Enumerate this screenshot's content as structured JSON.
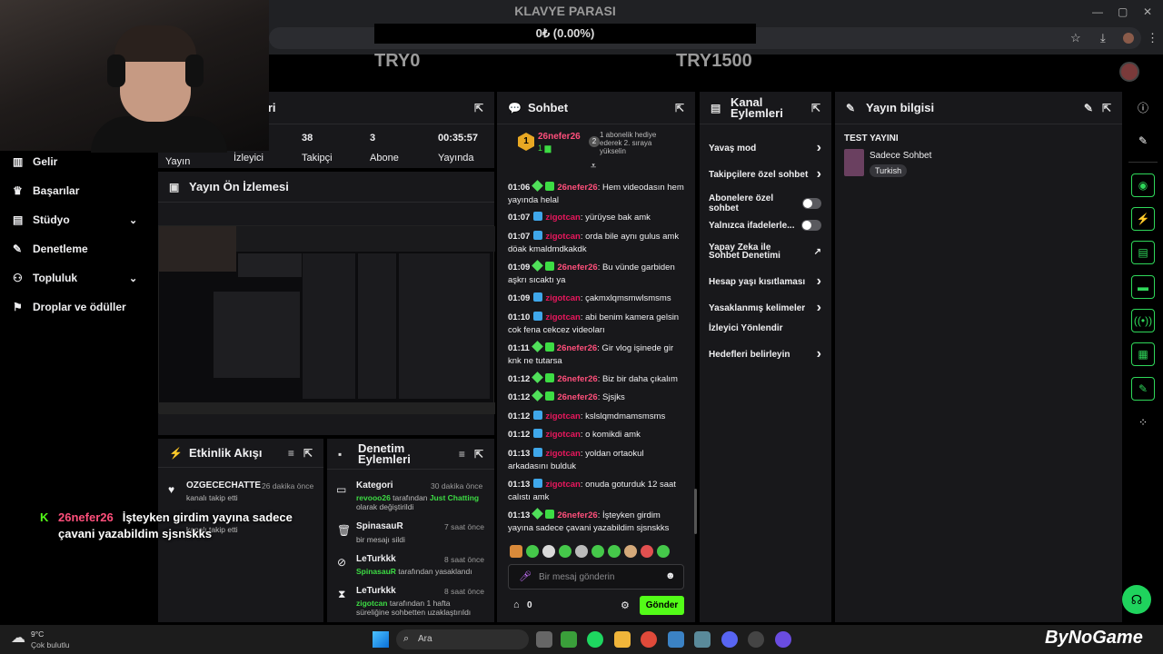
{
  "overlay": {
    "title": "KLAVYE PARASI",
    "progress": "0₺ (0.00%)",
    "progress_fraction": 0.0,
    "goal_min": "TRY0",
    "goal_max": "TRY1500"
  },
  "stats_panel": {
    "title_fragment": "leri",
    "stats": [
      {
        "value": "",
        "label": "Yayın"
      },
      {
        "value": "",
        "label": "İzleyici"
      },
      {
        "value": "38",
        "label": "Takipçi"
      },
      {
        "value": "3",
        "label": "Abone"
      },
      {
        "value": "00:35:57",
        "label": "Yayında"
      }
    ]
  },
  "nav": [
    {
      "label": "Gelir",
      "icon": "chart-icon"
    },
    {
      "label": "Başarılar",
      "icon": "trophy-icon"
    },
    {
      "label": "Stüdyo",
      "icon": "studio-icon",
      "expandable": true
    },
    {
      "label": "Denetleme",
      "icon": "wrench-icon"
    },
    {
      "label": "Topluluk",
      "icon": "people-icon",
      "expandable": true
    },
    {
      "label": "Droplar ve ödüller",
      "icon": "gift-icon"
    }
  ],
  "preview": {
    "title": "Yayın Ön İzlemesi"
  },
  "activity": {
    "title": "Etkinlik Akışı",
    "items": [
      {
        "name": "OZGECECHATTE",
        "time": "26 dakika önce",
        "desc": "kanalı takip etti"
      },
      {
        "name": "",
        "time": "",
        "desc": "kanalı takip etti"
      }
    ]
  },
  "mod": {
    "title": "Denetim Eylemleri",
    "items": [
      {
        "title": "Kategori",
        "time": "30 dakika önce",
        "user": "revooo26",
        "mid": " tarafından ",
        "target": "Just Chatting",
        "rest": "olarak değiştirildi"
      },
      {
        "title": "SpinasauR",
        "time": "7 saat önce",
        "rest": "bir mesajı sildi"
      },
      {
        "title": "LeTurkkk",
        "time": "8 saat önce",
        "user": "SpinasauR",
        "mid": " tarafından yasaklandı"
      },
      {
        "title": "LeTurkkk",
        "time": "8 saat önce",
        "user": "zigotcan",
        "mid": " tarafından 1 hafta",
        "rest": "süreliğine sohbetten uzaklaştırıldı"
      }
    ]
  },
  "chat": {
    "title": "Sohbet",
    "pinned": {
      "rank": "1",
      "user": "26nefer26",
      "count": "1",
      "sub_count": "2",
      "text": "1 abonelik hediye ederek 2. sıraya yükselin"
    },
    "messages": [
      {
        "time": "01:06",
        "user": "26nefer26",
        "text": ": Hem videodasın hem yayında helal",
        "type": 1
      },
      {
        "time": "01:07",
        "user": "zigotcan",
        "text": ": yürüyse bak amk",
        "type": 2
      },
      {
        "time": "01:07",
        "user": "zigotcan",
        "text": ": orda bile aynı gulus amk döak kmaldmdkakdk",
        "type": 2
      },
      {
        "time": "01:09",
        "user": "26nefer26",
        "text": ": Bu vünde garbiden aşkrı sıcaktı ya",
        "type": 1
      },
      {
        "time": "01:09",
        "user": "zigotcan",
        "text": ": çakmxlqmsmwlsmsms",
        "type": 2
      },
      {
        "time": "01:10",
        "user": "zigotcan",
        "text": ": abi benim kamera gelsin cok fena cekcez videoları",
        "type": 2
      },
      {
        "time": "01:11",
        "user": "26nefer26",
        "text": ": Gir vlog işinede gir knk ne tutarsa",
        "type": 1
      },
      {
        "time": "01:12",
        "user": "26nefer26",
        "text": ": Biz bir daha çıkalım",
        "type": 1
      },
      {
        "time": "01:12",
        "user": "26nefer26",
        "text": ": Sjsjks",
        "type": 1
      },
      {
        "time": "01:12",
        "user": "zigotcan",
        "text": ": kslslqmdmamsmsms",
        "type": 2
      },
      {
        "time": "01:12",
        "user": "zigotcan",
        "text": ": o komikdi amk",
        "type": 2
      },
      {
        "time": "01:13",
        "user": "zigotcan",
        "text": ": yoldan ortaokul arkadasını bulduk",
        "type": 2
      },
      {
        "time": "01:13",
        "user": "zigotcan",
        "text": ": onuda goturduk 12 saat calıstı amk",
        "type": 2
      },
      {
        "time": "01:13",
        "user": "26nefer26",
        "text": ": İşteyken girdim yayına sadece çavani yazabildim sjsnskks",
        "type": 1
      }
    ],
    "input_placeholder": "Bir mesaj gönderin",
    "points": "0",
    "send": "Gönder"
  },
  "channel_actions": {
    "title": "Kanal Eylemleri",
    "items": [
      {
        "label": "Yavaş mod",
        "ctl": "chevron"
      },
      {
        "label": "Takipçilere özel sohbet",
        "ctl": "chevron"
      },
      {
        "label": "Abonelere özel sohbet",
        "ctl": "toggle"
      },
      {
        "label": "Yalnızca ifadelerle...",
        "ctl": "toggle"
      },
      {
        "label": "Yapay Zeka ile Sohbet Denetimi",
        "ctl": "external"
      },
      {
        "label": "Hesap yaşı kısıtlaması",
        "ctl": "chevron"
      },
      {
        "label": "Yasaklanmış kelimeler",
        "ctl": "chevron"
      },
      {
        "label": "İzleyici Yönlendir",
        "ctl": "none"
      },
      {
        "label": "Hedefleri belirleyin",
        "ctl": "chevron"
      }
    ]
  },
  "stream_info": {
    "title": "Yayın bilgisi",
    "stream_title": "TEST YAYINI",
    "category": "Sadece Sohbet",
    "tag": "Turkish"
  },
  "overlay_chat": {
    "user": "26nefer26",
    "text": "İşteyken girdim yayına sadece çavani yazabildim sjsnskks"
  },
  "taskbar": {
    "temp": "9°C",
    "weather": "Çok bulutlu",
    "search": "Ara",
    "brand": "ByNoGame"
  }
}
